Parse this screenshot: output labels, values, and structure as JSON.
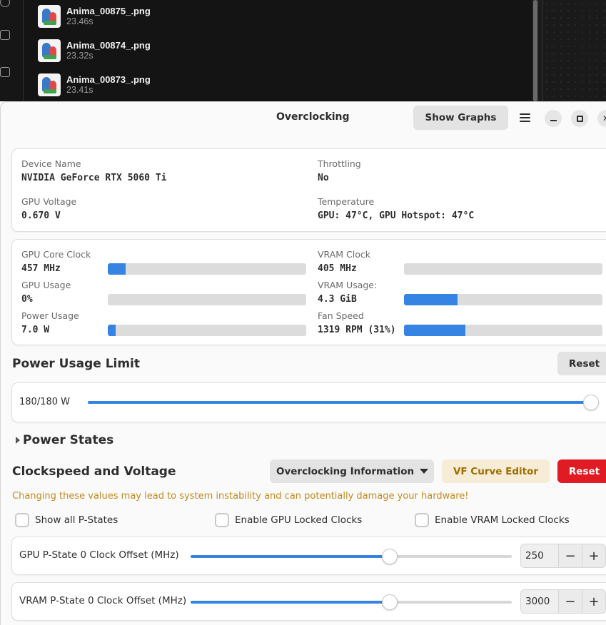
{
  "background_app": {
    "files": [
      {
        "name": "Anima_00875_.png",
        "time": "23.46s"
      },
      {
        "name": "Anima_00874_.png",
        "time": "23.32s"
      },
      {
        "name": "Anima_00873_.png",
        "time": "23.41s"
      }
    ]
  },
  "window": {
    "title": "Overclocking",
    "show_graphs_label": "Show Graphs",
    "icons": {
      "menu": "hamburger-menu-icon",
      "minimize": "minimize-icon",
      "maximize": "maximize-icon",
      "close": "close-icon"
    }
  },
  "device_info": {
    "device_name_label": "Device Name",
    "device_name": "NVIDIA GeForce RTX 5060 Ti",
    "throttling_label": "Throttling",
    "throttling": "No",
    "gpu_voltage_label": "GPU Voltage",
    "gpu_voltage": "0.670 V",
    "temperature_label": "Temperature",
    "temperature": "GPU: 47°C, GPU Hotspot: 47°C"
  },
  "stats": {
    "gpu_core_clock": {
      "label": "GPU Core Clock",
      "value": "457 MHz",
      "fill": 0.09
    },
    "vram_clock": {
      "label": "VRAM Clock",
      "value": "405 MHz",
      "fill": 0.0
    },
    "gpu_usage": {
      "label": "GPU Usage",
      "value": "0%",
      "fill": 0.0
    },
    "vram_usage": {
      "label": "VRAM Usage:",
      "value": "4.3 GiB",
      "fill": 0.27
    },
    "power_usage": {
      "label": "Power Usage",
      "value": "7.0 W",
      "fill": 0.04
    },
    "fan_speed": {
      "label": "Fan Speed",
      "value": "1319 RPM (31%)",
      "fill": 0.31
    }
  },
  "power_limit": {
    "title": "Power Usage Limit",
    "reset_label": "Reset",
    "value": "180/180 W",
    "fraction": 1.0
  },
  "power_states": {
    "title": "Power States"
  },
  "clockspeed": {
    "title": "Clockspeed and Voltage",
    "dropdown_value": "Overclocking Information",
    "vf_curve_label": "VF Curve Editor",
    "reset_label": "Reset",
    "warning": "Changing these values may lead to system instability and can potentially damage your hardware!",
    "checkboxes": [
      "Show all P-States",
      "Enable GPU Locked Clocks",
      "Enable VRAM Locked Clocks"
    ],
    "accent_warning": "#c38a1e",
    "accent_destructive": "#e01b24"
  },
  "offsets": [
    {
      "label": "GPU P-State 0 Clock Offset (MHz)",
      "value": "250",
      "fraction": 0.62
    },
    {
      "label": "VRAM P-State 0 Clock Offset (MHz)",
      "value": "3000",
      "fraction": 0.62
    }
  ],
  "spin_symbols": {
    "minus": "−",
    "plus": "+"
  }
}
